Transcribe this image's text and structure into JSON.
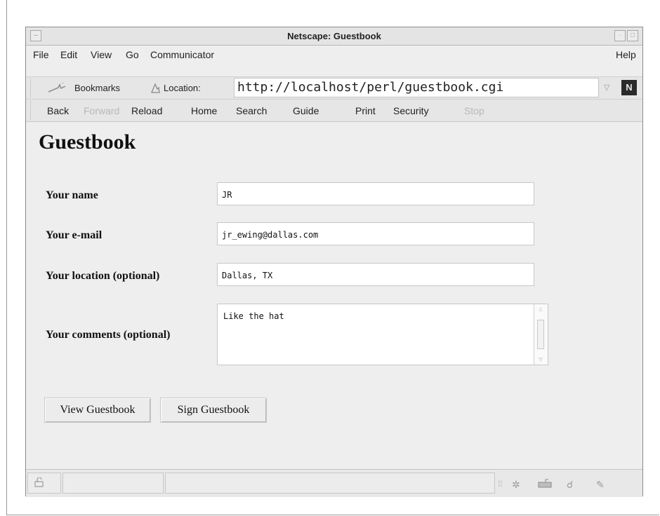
{
  "window": {
    "title": "Netscape: Guestbook",
    "min_glyph": "–",
    "right_glyphs": [
      "·",
      "□"
    ]
  },
  "menubar": {
    "file": "File",
    "edit": "Edit",
    "view": "View",
    "go": "Go",
    "communicator": "Communicator",
    "help": "Help"
  },
  "location_bar": {
    "bookmarks": "Bookmarks",
    "location_label": "Location:",
    "url": "http://localhost/perl/guestbook.cgi",
    "logo": "N"
  },
  "nav": {
    "back": "Back",
    "forward": "Forward",
    "reload": "Reload",
    "home": "Home",
    "search": "Search",
    "guide": "Guide",
    "print": "Print",
    "security": "Security",
    "stop": "Stop"
  },
  "page": {
    "heading": "Guestbook",
    "fields": {
      "name_label": "Your name",
      "name_value": "JR",
      "email_label": "Your e-mail",
      "email_value": "jr_ewing@dallas.com",
      "location_label": "Your location (optional)",
      "location_value": "Dallas, TX",
      "comments_label": "Your comments (optional)",
      "comments_value": "Like the hat"
    },
    "buttons": {
      "view": "View Guestbook",
      "sign": "Sign Guestbook"
    }
  },
  "icons": {
    "bookmarks": "bookmark-icon",
    "location": "location-icon",
    "security": "lock-icon",
    "status": [
      "component-icon",
      "mail-icon",
      "discussion-icon",
      "composer-icon"
    ]
  }
}
